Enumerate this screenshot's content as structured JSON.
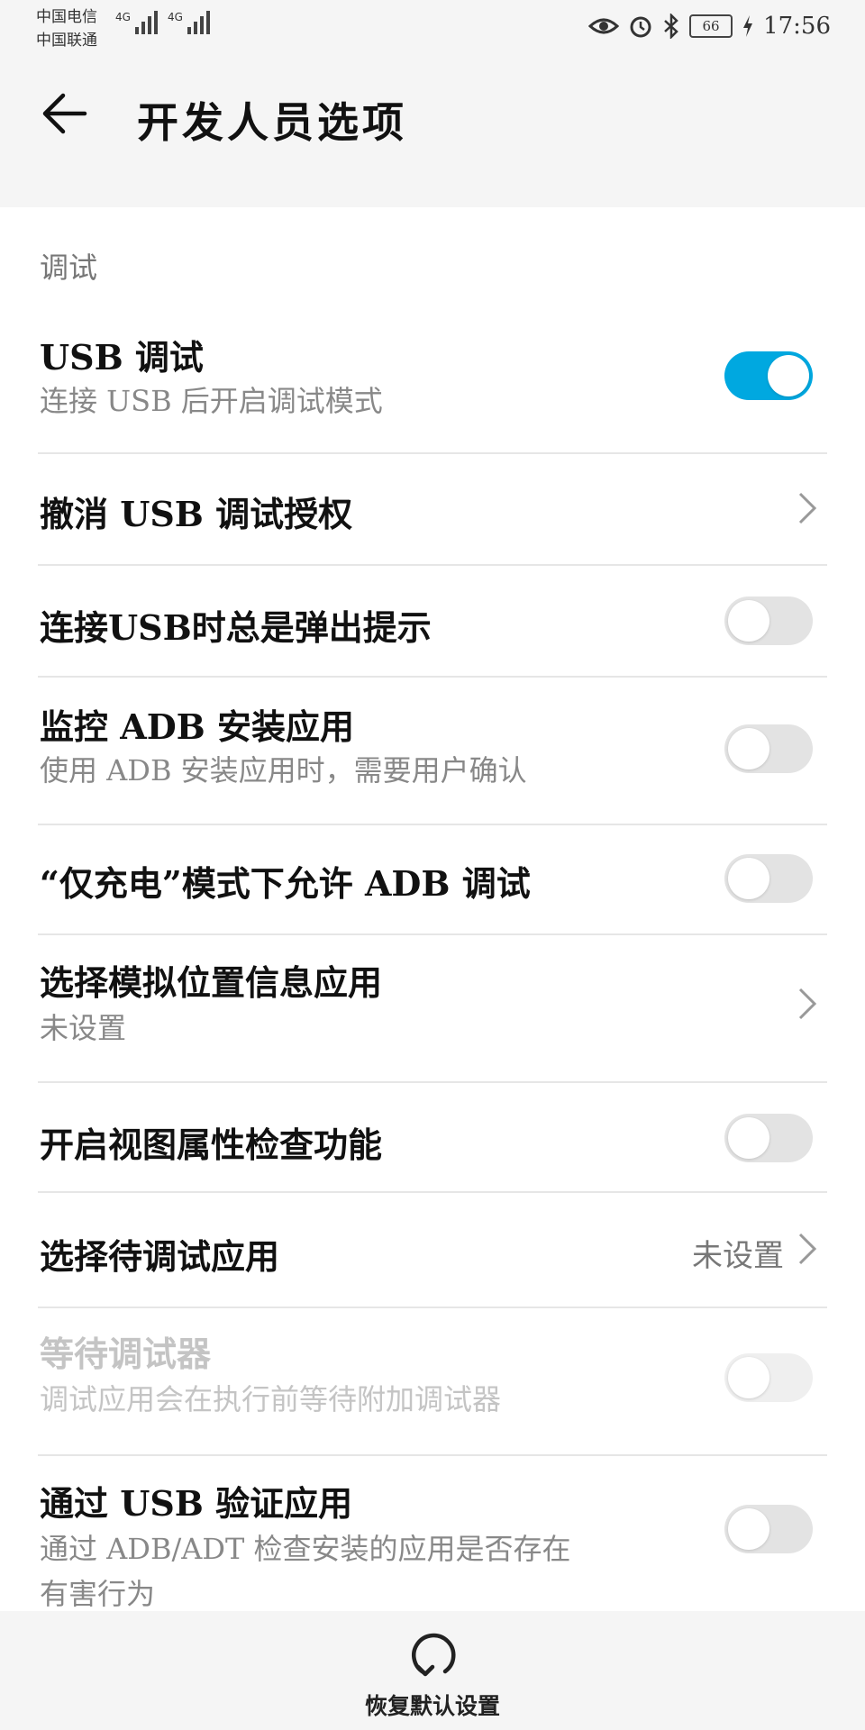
{
  "status_bar": {
    "carrier_1": "中国电信",
    "carrier_2": "中国联通",
    "network_1": "4G",
    "network_2": "4G",
    "battery": "66",
    "time": "17:56"
  },
  "header": {
    "title": "开发人员选项"
  },
  "section": {
    "label": "调试"
  },
  "rows": {
    "usb_debugging": {
      "title": "USB 调试",
      "subtitle": "连接 USB 后开启调试模式",
      "toggle": "on"
    },
    "revoke_usb_auth": {
      "title": "撤消 USB 调试授权"
    },
    "usb_prompt": {
      "title": "连接USB时总是弹出提示",
      "toggle": "off"
    },
    "monitor_adb": {
      "title": "监控 ADB 安装应用",
      "subtitle": "使用 ADB 安装应用时，需要用户确认",
      "toggle": "off"
    },
    "charge_only_adb": {
      "title": "“仅充电”模式下允许 ADB 调试",
      "toggle": "off"
    },
    "mock_location": {
      "title": "选择模拟位置信息应用",
      "subtitle": "未设置"
    },
    "view_attr": {
      "title": "开启视图属性检查功能",
      "toggle": "off"
    },
    "debug_app": {
      "title": "选择待调试应用",
      "value": "未设置"
    },
    "wait_debugger": {
      "title": "等待调试器",
      "subtitle": "调试应用会在执行前等待附加调试器",
      "toggle": "off",
      "enabled": false
    },
    "verify_usb": {
      "title": "通过 USB 验证应用",
      "subtitle": "通过 ADB/ADT 检查安装的应用是否存在",
      "subtitle_2": "有害行为",
      "toggle": "off"
    }
  },
  "bottom": {
    "reset_label": "恢复默认设置"
  },
  "colors": {
    "accent": "#00a8e0",
    "toggle_off": "#e3e3e3",
    "disabled_text": "#c4c4c4"
  }
}
